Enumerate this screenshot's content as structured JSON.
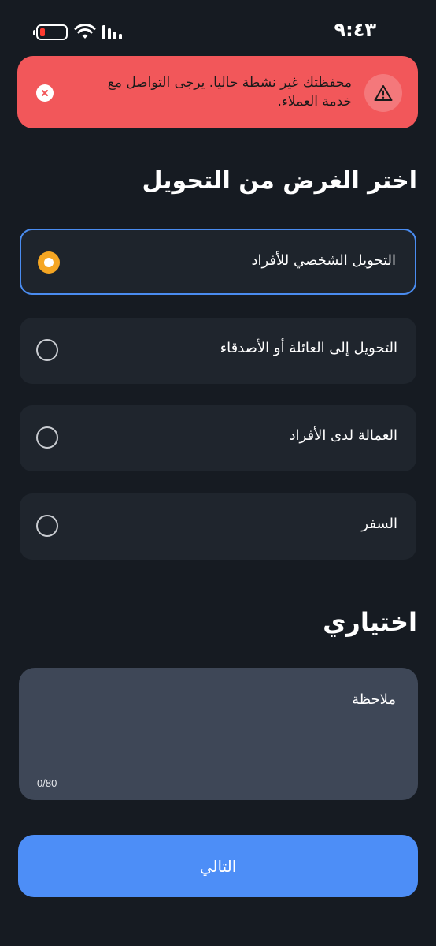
{
  "status_bar": {
    "time": "٩:٤٣",
    "battery_level_percent": 10
  },
  "alert": {
    "message": "محفظتك غير نشطة حاليا. يرجى التواصل مع خدمة العملاء.",
    "icon": "warning-icon",
    "close_icon": "close-icon",
    "color": "#f2575a"
  },
  "purpose": {
    "title": "اختر الغرض من التحويل",
    "options": [
      {
        "label": "التحويل الشخصي للأفراد",
        "selected": true
      },
      {
        "label": "التحويل إلى العائلة أو الأصدقاء",
        "selected": false
      },
      {
        "label": "العمالة لدى الأفراد",
        "selected": false
      },
      {
        "label": "السفر",
        "selected": false
      }
    ]
  },
  "optional": {
    "title": "اختياري",
    "note_placeholder": "ملاحظة",
    "note_value": "",
    "counter": "0/80"
  },
  "next_button": {
    "label": "التالي",
    "color": "#4d8ef7"
  },
  "colors": {
    "background": "#161b22",
    "selected_border": "#4a8cf0",
    "radio_selected": "#f5a623"
  }
}
